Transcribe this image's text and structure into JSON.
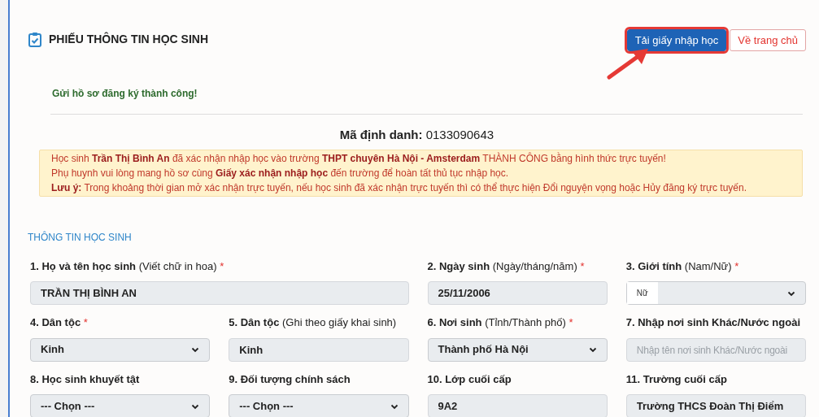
{
  "header": {
    "title": "PHIẾU THÔNG TIN HỌC SINH"
  },
  "actions": [
    {
      "label": "Tải giấy nhập học",
      "kind": "primary",
      "highlighted": true
    },
    {
      "label": "Về trang chủ",
      "kind": "outline",
      "highlighted": false
    }
  ],
  "success_message": "Gửi hồ sơ đăng ký thành công!",
  "identifier": {
    "label": "Mã định danh:",
    "value": "0133090643"
  },
  "notice": [
    "Học sinh **Trần Thị Bình An** đã xác nhận nhập học vào trường **THPT chuyên Hà Nội - Amsterdam** THÀNH CÔNG bằng hình thức trực tuyến!",
    "Phụ huynh vui lòng mang hồ sơ cùng **Giấy xác nhận nhập học** đến trường để hoàn tất thủ tục nhập học.",
    "**Lưu ý:** Trong khoảng thời gian mở xác nhận trực tuyến, nếu học sinh đã xác nhận trực tuyến thì có thể thực hiện Đổi nguyện vọng hoặc Hủy đăng ký trực tuyến."
  ],
  "section_title": "THÔNG TIN HỌC SINH",
  "fields": [
    {
      "label": "1. Họ và tên học sinh",
      "hint": "(Viết chữ in hoa)",
      "required_mark": "*",
      "kind": "input",
      "value": "TRẦN THỊ BÌNH AN",
      "wide": true
    },
    {
      "label": "2. Ngày sinh",
      "hint": "(Ngày/tháng/năm)",
      "required_mark": "*",
      "kind": "input",
      "value": "25/11/2006",
      "wide": false
    },
    {
      "label": "3. Giới tính",
      "hint": "(Nam/Nữ)",
      "required_mark": "*",
      "kind": "compact-select",
      "value": "Nữ",
      "wide": false
    },
    {
      "label": "4. Dân tộc",
      "required_mark": "*",
      "kind": "select",
      "value": "Kinh",
      "wide": false
    },
    {
      "label": "5. Dân tộc",
      "hint": "(Ghi theo giấy khai sinh)",
      "kind": "input",
      "value": "Kinh",
      "wide": false
    },
    {
      "label": "6. Nơi sinh",
      "hint": "(Tỉnh/Thành phố)",
      "required_mark": "*",
      "kind": "select",
      "value": "Thành phố Hà Nội",
      "wide": false
    },
    {
      "label": "7. Nhập nơi sinh Khác/Nước ngoài",
      "kind": "input",
      "placeholder": "Nhập tên nơi sinh Khác/Nước ngoài",
      "wide": false
    },
    {
      "label": "8. Học sinh khuyết tật",
      "kind": "select",
      "value": "--- Chọn ---",
      "wide": false
    },
    {
      "label": "9. Đối tượng chính sách",
      "kind": "select",
      "value": "--- Chọn ---",
      "wide": false
    },
    {
      "label": "10. Lớp cuối cấp",
      "kind": "input",
      "value": "9A2",
      "wide": false
    },
    {
      "label": "11. Trường cuối cấp",
      "kind": "input",
      "value": "Trường THCS Đoàn Thị Điểm",
      "wide": false
    }
  ]
}
